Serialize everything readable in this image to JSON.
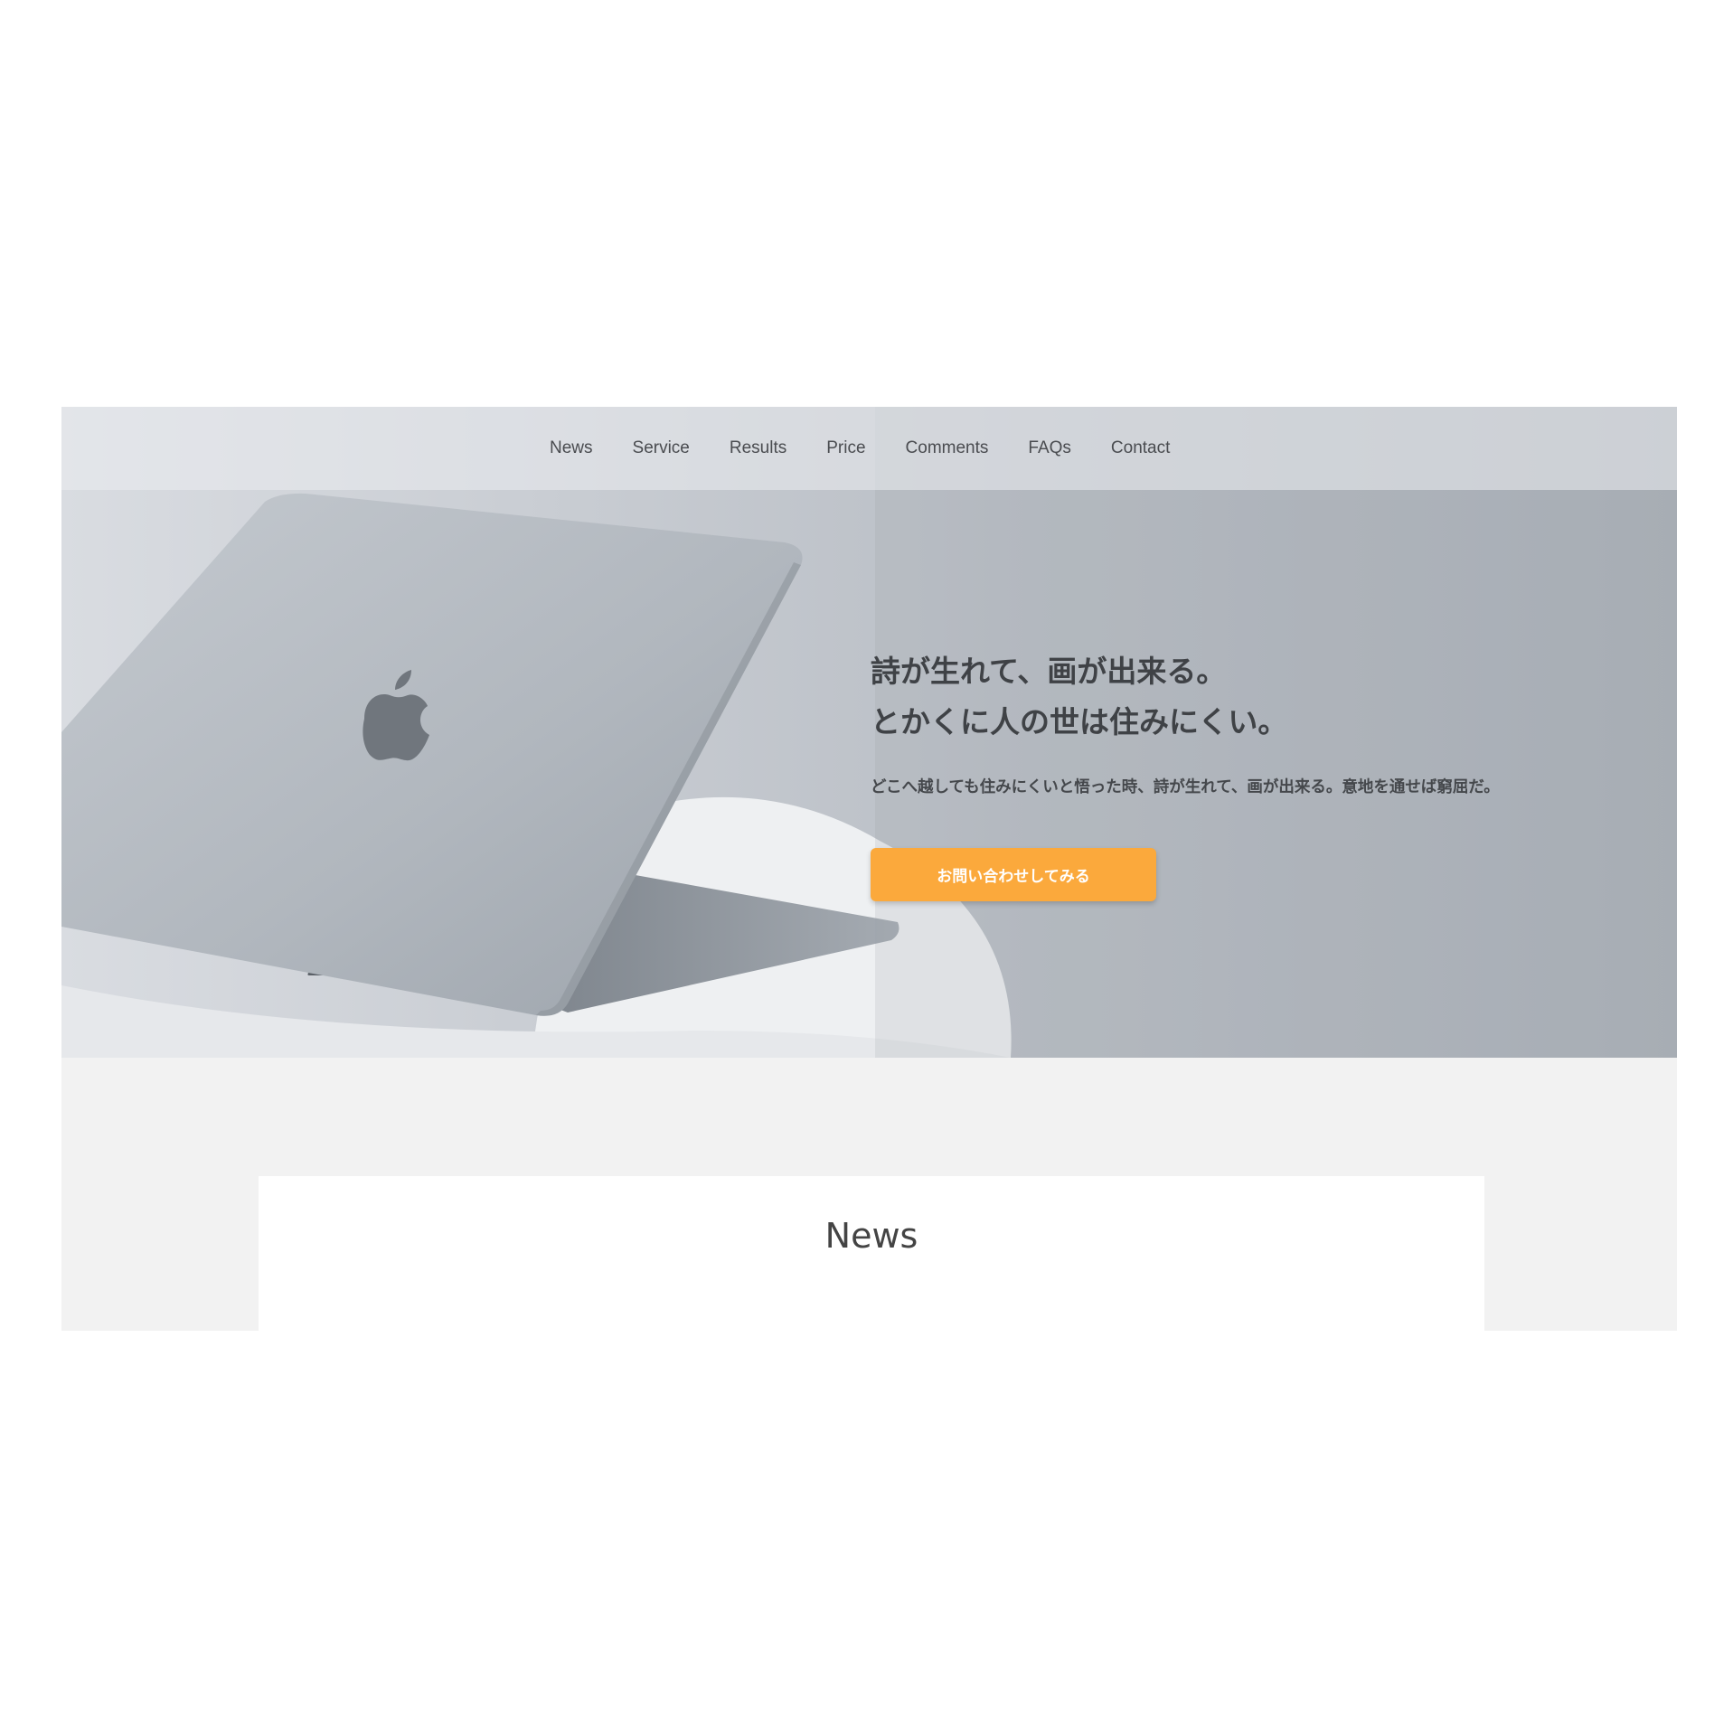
{
  "nav": {
    "items": [
      {
        "label": "News"
      },
      {
        "label": "Service"
      },
      {
        "label": "Results"
      },
      {
        "label": "Price"
      },
      {
        "label": "Comments"
      },
      {
        "label": "FAQs"
      },
      {
        "label": "Contact"
      }
    ]
  },
  "hero": {
    "title_line1": "詩が生れて、画が出来る。",
    "title_line2": "とかくに人の世は住みにくい。",
    "description": "どこへ越しても住みにくいと悟った時、詩が生れて、画が出来る。意地を通せば窮屈だ。",
    "cta_label": "お問い合わせしてみる",
    "image_icon": "laptop-photo"
  },
  "news": {
    "title": "News"
  },
  "colors": {
    "cta": "#fba93c",
    "text_dark": "#3f4246",
    "section_bg": "#f2f2f2",
    "card_bg": "#ffffff"
  }
}
